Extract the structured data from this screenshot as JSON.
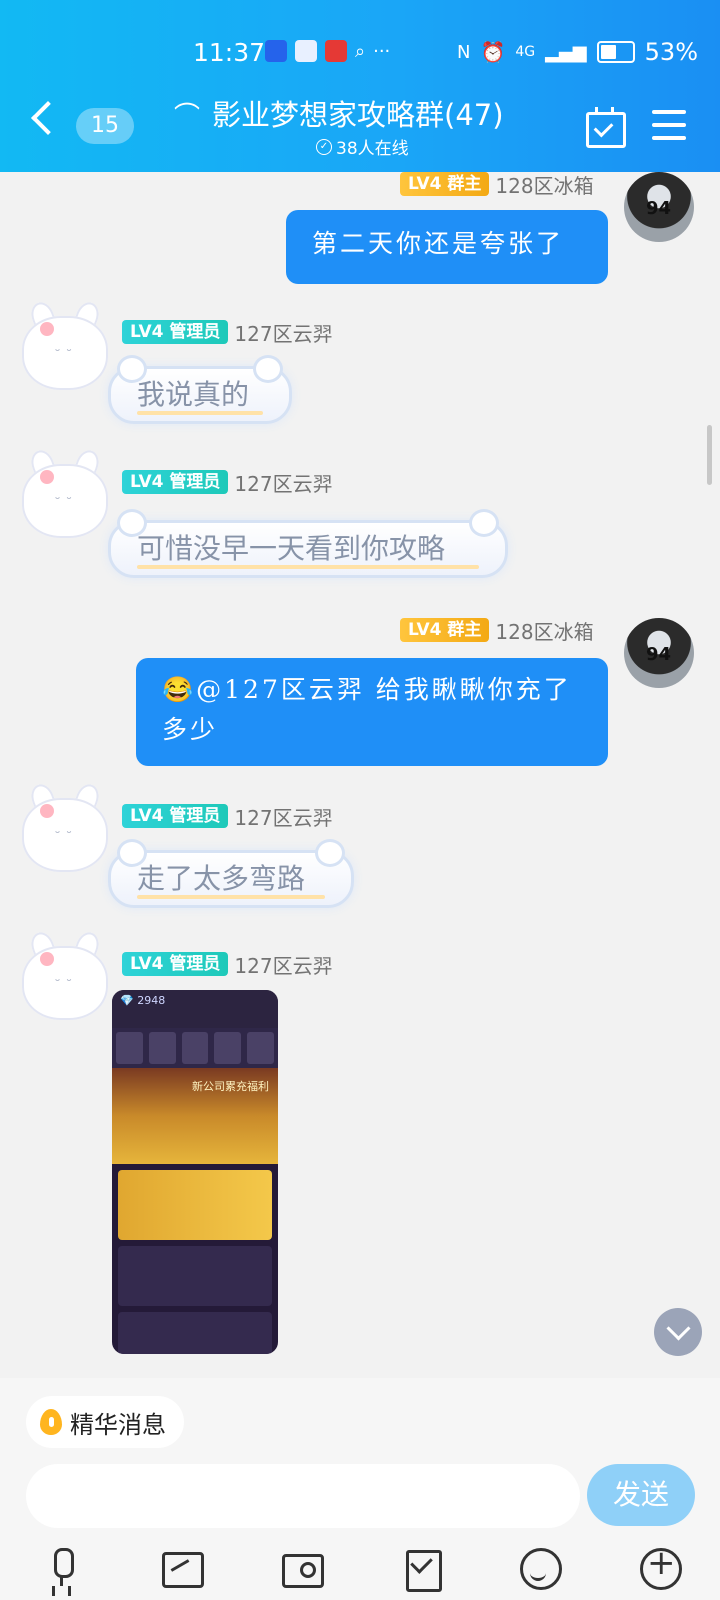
{
  "status_bar": {
    "time": "11:37",
    "battery": "53%",
    "network": "4G"
  },
  "header": {
    "back_count": "15",
    "title": "影业梦想家攻略群(47)",
    "online": "38人在线"
  },
  "messages": [
    {
      "side": "right",
      "level": "LV4",
      "role": "群主",
      "sender": "128区冰箱",
      "text": "第二天你还是夸张了",
      "avatar_text": "94"
    },
    {
      "side": "left",
      "level": "LV4",
      "role": "管理员",
      "sender": "127区云羿",
      "text": "我说真的"
    },
    {
      "side": "left",
      "level": "LV4",
      "role": "管理员",
      "sender": "127区云羿",
      "text": "可惜没早一天看到你攻略"
    },
    {
      "side": "right",
      "level": "LV4",
      "role": "群主",
      "sender": "128区冰箱",
      "text": "😂@127区云羿 给我瞅瞅你充了多少",
      "avatar_text": "94"
    },
    {
      "side": "left",
      "level": "LV4",
      "role": "管理员",
      "sender": "127区云羿",
      "text": "走了太多弯路"
    },
    {
      "side": "left",
      "level": "LV4",
      "role": "管理员",
      "sender": "127区云羿",
      "text": "",
      "image_caption": "新公司累充福利"
    }
  ],
  "bottom": {
    "essence_label": "精华消息",
    "input_placeholder": "",
    "send_label": "发送"
  },
  "colors": {
    "header": "#1aa6f7",
    "bubble_self": "#1f8ff7",
    "owner_tag": "#f3a914",
    "admin_tag": "#1ec9b9"
  }
}
